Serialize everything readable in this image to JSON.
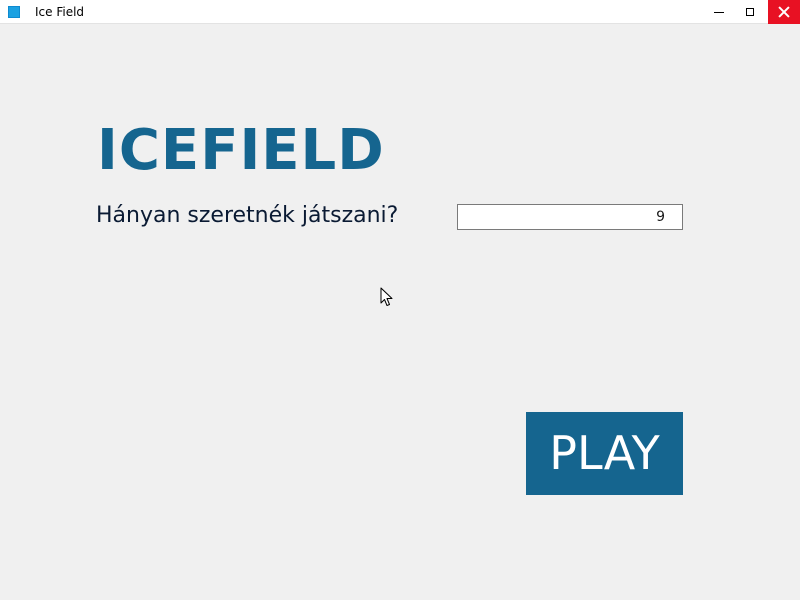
{
  "window": {
    "title": "Ice Field",
    "app_icon": "app-icon",
    "controls": {
      "minimize_icon": "minimize-icon",
      "maximize_icon": "maximize-icon",
      "close_icon": "close-icon",
      "close_color": "#e81123"
    }
  },
  "main": {
    "logo": "ICEFIELD",
    "prompt": "Hányan szeretnék játszani?",
    "player_count": "9",
    "play_label": "PLAY"
  },
  "colors": {
    "accent": "#15658f",
    "background": "#f0f0f0",
    "text": "#0a1a33"
  },
  "icons": {
    "cursor": "mouse-cursor-icon"
  }
}
